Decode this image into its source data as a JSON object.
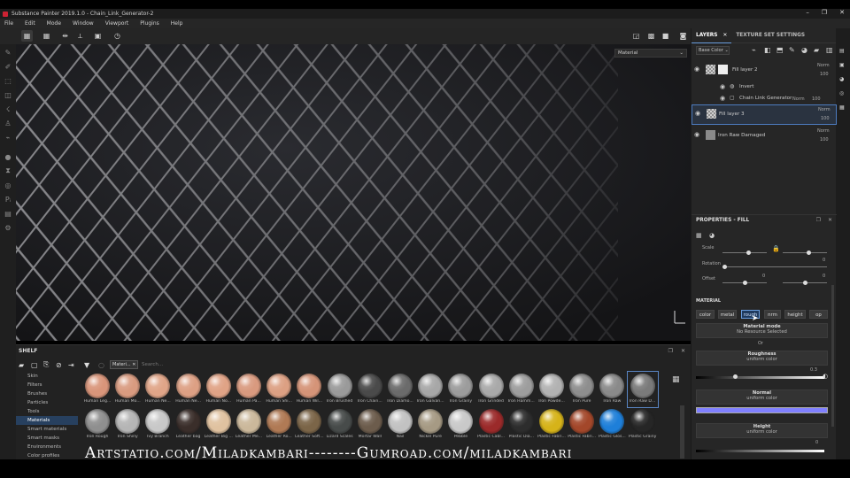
{
  "window": {
    "title": "Substance Painter 2019.1.0 - Chain_Link_Generator-2",
    "controls": [
      "–",
      "❐",
      "✕"
    ]
  },
  "menu": [
    "File",
    "Edit",
    "Mode",
    "Window",
    "Viewport",
    "Plugins",
    "Help"
  ],
  "viewport": {
    "channel_dropdown": "Material"
  },
  "layers_panel": {
    "tabs": [
      "LAYERS",
      "TEXTURE SET SETTINGS"
    ],
    "channel_select": "Base Color",
    "layers": [
      {
        "name": "Fill layer 2",
        "blend": "Norm",
        "opacity": "100"
      },
      {
        "name": "Invert"
      },
      {
        "name": "Chain Link Generator",
        "blend": "Norm",
        "opacity": "100"
      },
      {
        "name": "Fill layer 3",
        "blend": "Norm",
        "opacity": "100"
      },
      {
        "name": "Iron Raw Damaged",
        "blend": "Norm",
        "opacity": "100"
      }
    ]
  },
  "properties": {
    "title": "PROPERTIES - FILL",
    "params": [
      {
        "label": "Scale"
      },
      {
        "label": "Rotation",
        "value": "0"
      },
      {
        "label": "Offset",
        "value_a": "0",
        "value_b": "0"
      }
    ],
    "material_heading": "MATERIAL",
    "channels": [
      {
        "label": "color",
        "on": false
      },
      {
        "label": "metal",
        "on": false
      },
      {
        "label": "rough",
        "on": true
      },
      {
        "label": "nrm",
        "on": false
      },
      {
        "label": "height",
        "on": false
      },
      {
        "label": "op",
        "on": false
      }
    ],
    "material_mode": {
      "title": "Material mode",
      "sub": "No Resource Selected"
    },
    "or_text": "Or",
    "roughness": {
      "title": "Roughness",
      "sub": "uniform color",
      "value": "0.3",
      "level": 0.3
    },
    "normal": {
      "title": "Normal",
      "sub": "uniform color",
      "swatch": "#8080ff"
    },
    "height": {
      "title": "Height",
      "sub": "uniform color",
      "value": "0"
    }
  },
  "shelf": {
    "title": "SHELF",
    "filter_tag": "Materi...",
    "search_placeholder": "Search...",
    "categories": [
      "Skin",
      "Filters",
      "Brushes",
      "Particles",
      "Tools",
      "Materials",
      "Smart materials",
      "Smart masks",
      "Environments",
      "Color profiles"
    ],
    "active_category": "Materials",
    "row1": [
      {
        "label": "Human Leg...",
        "color": "#d9957a"
      },
      {
        "label": "Human Mo...",
        "color": "#d99b80"
      },
      {
        "label": "Human Ne...",
        "color": "#e0a588"
      },
      {
        "label": "Human Ne...",
        "color": "#dda084"
      },
      {
        "label": "Human No...",
        "color": "#e0a386"
      },
      {
        "label": "Human Pa...",
        "color": "#d99a7f"
      },
      {
        "label": "Human Shi...",
        "color": "#dca083"
      },
      {
        "label": "Human Wil...",
        "color": "#d59478"
      },
      {
        "label": "Iron Brushed",
        "color": "#9a9a9a"
      },
      {
        "label": "Iron Chain...",
        "color": "#4a4a4a"
      },
      {
        "label": "Iron Diamo...",
        "color": "#6b6b6b"
      },
      {
        "label": "Iron Galvan...",
        "color": "#a7a7a7"
      },
      {
        "label": "Iron Grainy",
        "color": "#9c9c9c"
      },
      {
        "label": "Iron Grinded",
        "color": "#a9a9a9"
      },
      {
        "label": "Iron Hamm...",
        "color": "#9d9d9d"
      },
      {
        "label": "Iron Powde...",
        "color": "#b2b2b2"
      },
      {
        "label": "Iron Pure",
        "color": "#8e8e8e"
      },
      {
        "label": "Iron Raw",
        "color": "#8a8a8a"
      },
      {
        "label": "Iron Raw D...",
        "color": "#7a7a7a"
      }
    ],
    "row2": [
      {
        "label": "Iron Rough",
        "color": "#8f8f8f"
      },
      {
        "label": "Iron Shiny",
        "color": "#b5b5b5"
      },
      {
        "label": "Ivy Branch",
        "color": "#c8c8c8"
      },
      {
        "label": "Leather bag",
        "color": "#3a2e2a"
      },
      {
        "label": "Leather Big ...",
        "color": "#e0c2a0"
      },
      {
        "label": "Leather Me...",
        "color": "#cbb89b"
      },
      {
        "label": "Leather Ro...",
        "color": "#b07a55"
      },
      {
        "label": "Leather Soft...",
        "color": "#7b6548"
      },
      {
        "label": "Lizard Scales",
        "color": "#474b4a"
      },
      {
        "label": "Mortar Wall",
        "color": "#6c5c4c"
      },
      {
        "label": "Nail",
        "color": "#c2c2c2"
      },
      {
        "label": "Nickel Pure",
        "color": "#a69a84"
      },
      {
        "label": "Pebble",
        "color": "#c9c9c9"
      },
      {
        "label": "Plastic Cabl...",
        "color": "#9b2a2a"
      },
      {
        "label": "Plastic Dia...",
        "color": "#2d2d2d"
      },
      {
        "label": "Plastic Fabri...",
        "color": "#d6b319"
      },
      {
        "label": "Plastic Fabri...",
        "color": "#a3472a"
      },
      {
        "label": "Plastic Glos...",
        "color": "#1e7fd9"
      },
      {
        "label": "Plastic Grainy",
        "color": "#262626"
      }
    ]
  },
  "watermark": "Artstatio.com/Miladkambari--------Gumroad.com/miladkambari"
}
